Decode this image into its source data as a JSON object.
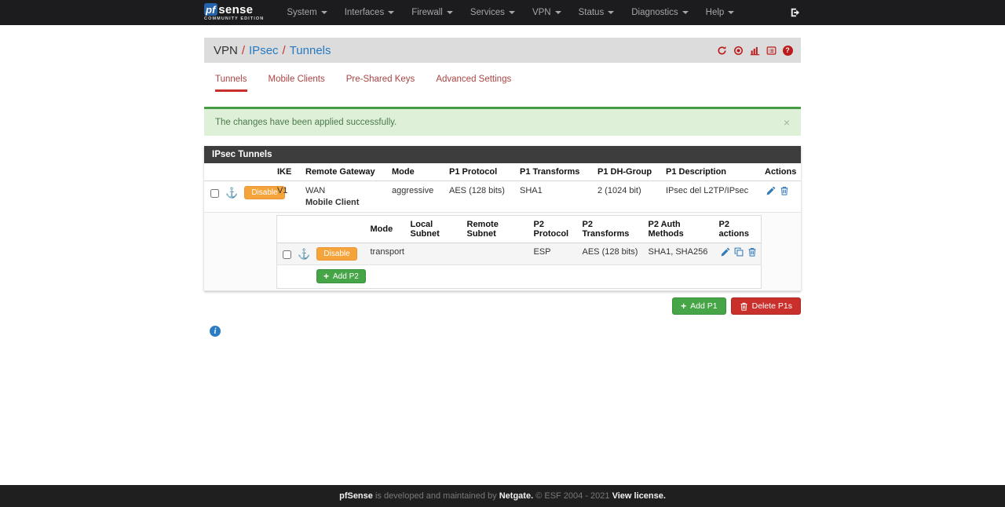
{
  "navbar": {
    "brand": {
      "pf": "pf",
      "sense": "sense",
      "subtitle": "COMMUNITY EDITION"
    },
    "items": [
      {
        "label": "System"
      },
      {
        "label": "Interfaces"
      },
      {
        "label": "Firewall"
      },
      {
        "label": "Services"
      },
      {
        "label": "VPN"
      },
      {
        "label": "Status"
      },
      {
        "label": "Diagnostics"
      },
      {
        "label": "Help"
      }
    ]
  },
  "breadcrumb": {
    "root": "VPN",
    "separator": "/",
    "section": "IPsec",
    "page": "Tunnels"
  },
  "header_icons": {
    "help_glyph": "?"
  },
  "tabs": [
    {
      "label": "Tunnels",
      "active": true
    },
    {
      "label": "Mobile Clients",
      "active": false
    },
    {
      "label": "Pre-Shared Keys",
      "active": false
    },
    {
      "label": "Advanced Settings",
      "active": false
    }
  ],
  "alert": {
    "text": "The changes have been applied successfully.",
    "close_glyph": "×"
  },
  "panel": {
    "title": "IPsec Tunnels"
  },
  "p1": {
    "headers": [
      "IKE",
      "Remote Gateway",
      "Mode",
      "P1 Protocol",
      "P1 Transforms",
      "P1 DH-Group",
      "P1 Description",
      "Actions"
    ],
    "row": {
      "disable_label": "Disable",
      "anchor_glyph": "⚓",
      "ike": "V1",
      "remote_gateway": "WAN",
      "remote_gateway_sub": "Mobile Client",
      "mode": "aggressive",
      "protocol": "AES (128 bits)",
      "transforms": "SHA1",
      "dh_group": "2 (1024 bit)",
      "description": "IPsec del L2TP/IPsec"
    }
  },
  "p2": {
    "headers": [
      "Mode",
      "Local Subnet",
      "Remote Subnet",
      "P2 Protocol",
      "P2 Transforms",
      "P2 Auth Methods",
      "P2 actions"
    ],
    "row": {
      "disable_label": "Disable",
      "anchor_glyph": "⚓",
      "mode": "transport",
      "local_subnet": "",
      "remote_subnet": "",
      "protocol": "ESP",
      "transforms": "AES (128 bits)",
      "auth_methods": "SHA1, SHA256"
    },
    "add_label": "Add P2",
    "plus_glyph": "+"
  },
  "page_actions": {
    "add_p1": "Add P1",
    "delete_p1s": "Delete P1s",
    "plus_glyph": "+"
  },
  "info_glyph": "i",
  "footer": {
    "brand": "pfSense",
    "text_developed": " is developed and maintained by ",
    "netgate": "Netgate.",
    "copyright": " © ESF 2004 - 2021 ",
    "license": "View license."
  },
  "colors": {
    "navbar_bg": "#1c1c1e",
    "breadcrumb_bg": "#dcdcdc",
    "accent_red": "#c9302c",
    "tab_red": "#a94442",
    "link_blue": "#2779c2",
    "action_blue": "#337ab7",
    "warning_orange": "#f5a43c",
    "success_green": "#46a546",
    "danger_red": "#c9302c",
    "alert_bg": "#dff0d8",
    "alert_border": "#449d44",
    "panel_header_bg": "#3d3d3d",
    "footer_bg": "#1f1f1f"
  }
}
